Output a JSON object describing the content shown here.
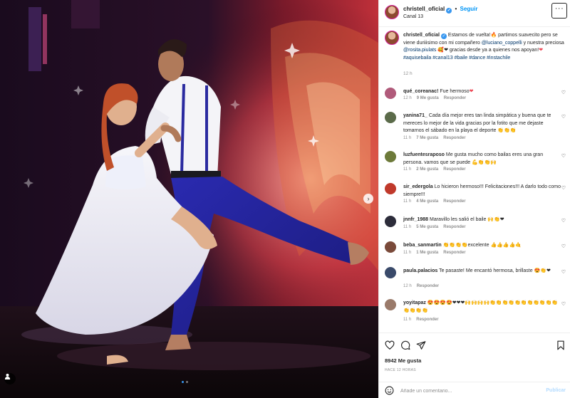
{
  "header": {
    "username": "christell_oficial",
    "follow_label": "Seguir",
    "location": "Canal 13",
    "more_label": "···"
  },
  "caption": {
    "username": "christell_oficial",
    "text_1": "Estamos de vuelta!",
    "text_2": " partimos suavecito pero se viene duriiisimo con mi compañero ",
    "mention_1": "@luciano_coppelli",
    "text_3": " y nuestra preciosa ",
    "mention_2": "@rosita.piulats",
    "text_4": " gracias desde ya a quienes nos apoyan!",
    "hashtags": "#aquisebaila #canal13 #baile #dance #instachile",
    "time": "12 h"
  },
  "comments": [
    {
      "username": "qué_coreanac!",
      "text": "Fue hermoso",
      "emoji": "❤",
      "time": "12 h",
      "likes": "9 Me gusta",
      "reply": "Responder",
      "avatar_color": "#b05a7a"
    },
    {
      "username": "yanina71_",
      "text": "Cada día mejor eres tan linda simpática y buena que te mereces lo mejor de la vida gracias por la fotito que me dejaste tomarnos el sábado en la playa el deporte",
      "emoji": "👏👏👏",
      "time": "11 h",
      "likes": "7 Me gusta",
      "reply": "Responder",
      "avatar_color": "#5b6b4a"
    },
    {
      "username": "luzfuentesraposo",
      "text": "Me gusta mucho como bailas eres una gran persona. vamos que se puede",
      "emoji": "💪👏👏🙌",
      "time": "11 h",
      "likes": "2 Me gusta",
      "reply": "Responder",
      "avatar_color": "#6d7a3a"
    },
    {
      "username": "sir_edergola",
      "text": "Lo hicieron hermoso!!! Felicitaciones!!! A darlo todo como siempre!!!",
      "emoji": "",
      "time": "11 h",
      "likes": "4 Me gusta",
      "reply": "Responder",
      "avatar_color": "#c0392b"
    },
    {
      "username": "jnnfr_1988",
      "text": "Maravillo les salió el baile",
      "emoji": "🙌👏❤",
      "time": "11 h",
      "likes": "5 Me gusta",
      "reply": "Responder",
      "avatar_color": "#2c2c3a"
    },
    {
      "username": "beba_sanmartin",
      "text": "",
      "emoji_pre": "👏👏👏👏",
      "text_post": "excelente",
      "emoji": "👍👍👍👍🤙",
      "time": "11 h",
      "likes": "1 Me gusta",
      "reply": "Responder",
      "avatar_color": "#7a4a3a"
    },
    {
      "username": "paula.palacios",
      "text": "Te pasaste! Me encantó hermosa, brillaste",
      "emoji": "😍👏❤",
      "time": "12 h",
      "likes": "",
      "reply": "Responder",
      "avatar_color": "#3a4a6a"
    },
    {
      "username": "yoyitapaz",
      "text": "",
      "emoji": "😍😍😍😍❤❤❤🙌🙌🙌🙌👏👏👏👏👏👏👏👏👏👏👏👏👏👏👏",
      "time": "11 h",
      "likes": "",
      "reply": "Responder",
      "avatar_color": "#9a7a6a"
    }
  ],
  "actions": {
    "likes": "8942 Me gusta",
    "ago": "HACE 12 HORAS",
    "comment_placeholder": "Añade un comentario...",
    "post_label": "Publicar"
  },
  "carousel": {
    "next_label": "›",
    "slides": 2,
    "active": 0
  },
  "colors": {
    "link": "#00376b",
    "follow": "#0095f6",
    "verified": "#3897f0",
    "post_disabled": "#b3dbff"
  },
  "icons": [
    "heart-icon",
    "comment-icon",
    "share-icon",
    "bookmark-icon",
    "emoji-icon",
    "more-icon",
    "tag-user-icon",
    "next-arrow-icon"
  ]
}
